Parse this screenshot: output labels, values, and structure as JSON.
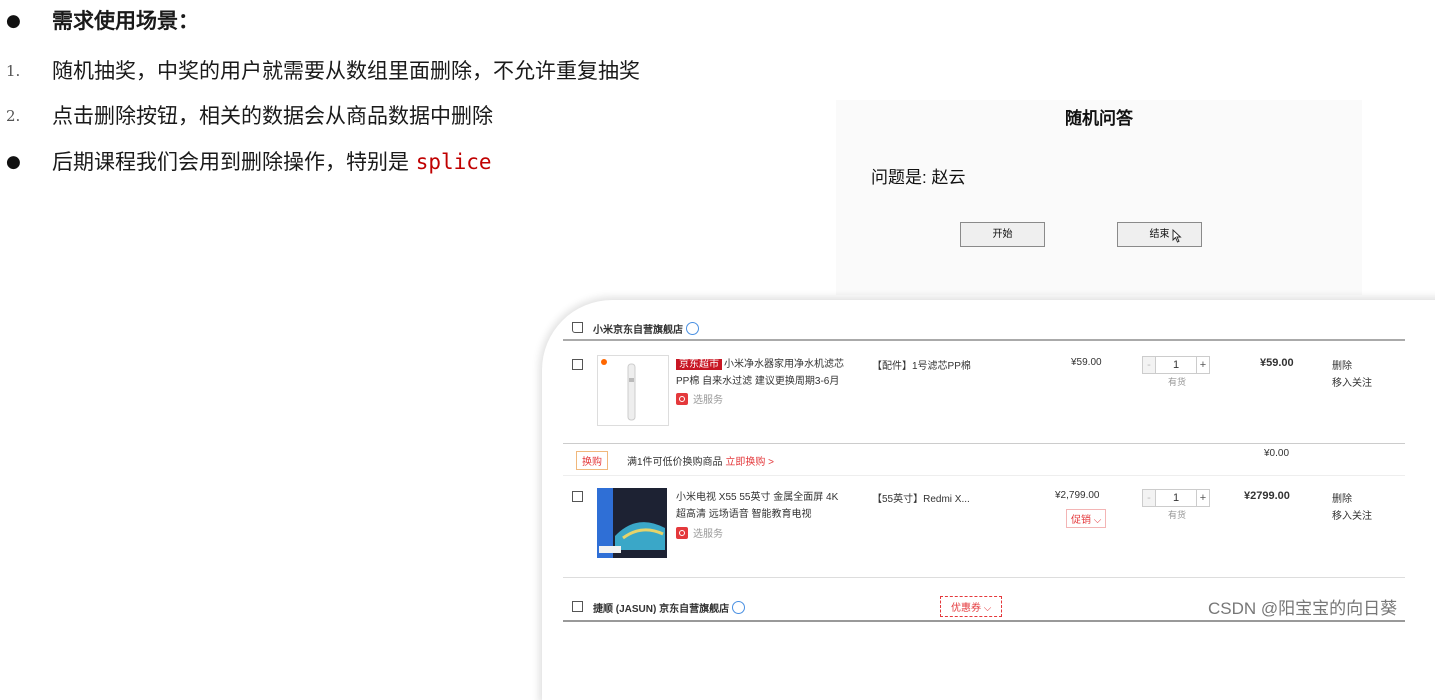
{
  "doc": {
    "heading": "需求使用场景：",
    "items": [
      {
        "marker": "1.",
        "text": "随机抽奖，中奖的用户就需要从数组里面删除，不允许重复抽奖"
      },
      {
        "marker": "2.",
        "text": "点击删除按钮，相关的数据会从商品数据中删除"
      }
    ],
    "last_item": {
      "text": "后期课程我们会用到删除操作，特别是 ",
      "code": "splice"
    }
  },
  "quiz": {
    "title": "随机问答",
    "question": "问题是: 赵云",
    "start_label": "开始",
    "end_label": "结束"
  },
  "cart": {
    "shop1": "小米京东自营旗舰店",
    "item1": {
      "tag": "京东超市",
      "name_line1": "小米净水器家用净水机滤芯",
      "name_line2": "PP棉 自来水过滤 建议更换周期3-6月",
      "service": "选服务",
      "spec": "【配件】1号滤芯PP棉",
      "price": "¥59.00",
      "qty": "1",
      "stock": "有货",
      "subtotal": "¥59.00",
      "delete": "删除",
      "follow": "移入关注"
    },
    "promo": {
      "tag": "换购",
      "text": "满1件可低价换购商品",
      "link": "立即换购 >",
      "amount": "¥0.00"
    },
    "item2": {
      "name_line1": "小米电视 X55 55英寸 金属全面屏 4K",
      "name_line2": "超高清 远场语音 智能教育电视",
      "service": "选服务",
      "spec": "【55英寸】Redmi X...",
      "price": "¥2,799.00",
      "promo_label": "促销",
      "qty": "1",
      "stock": "有货",
      "subtotal": "¥2799.00",
      "delete": "删除",
      "follow": "移入关注"
    },
    "shop2": "捷顺 (JASUN) 京东自营旗舰店",
    "coupon": "优惠券"
  },
  "watermark": "CSDN @阳宝宝的向日葵",
  "colors": {
    "code": "#c00000",
    "jd_red": "#e4393c",
    "link_blue": "#4a90e2"
  }
}
